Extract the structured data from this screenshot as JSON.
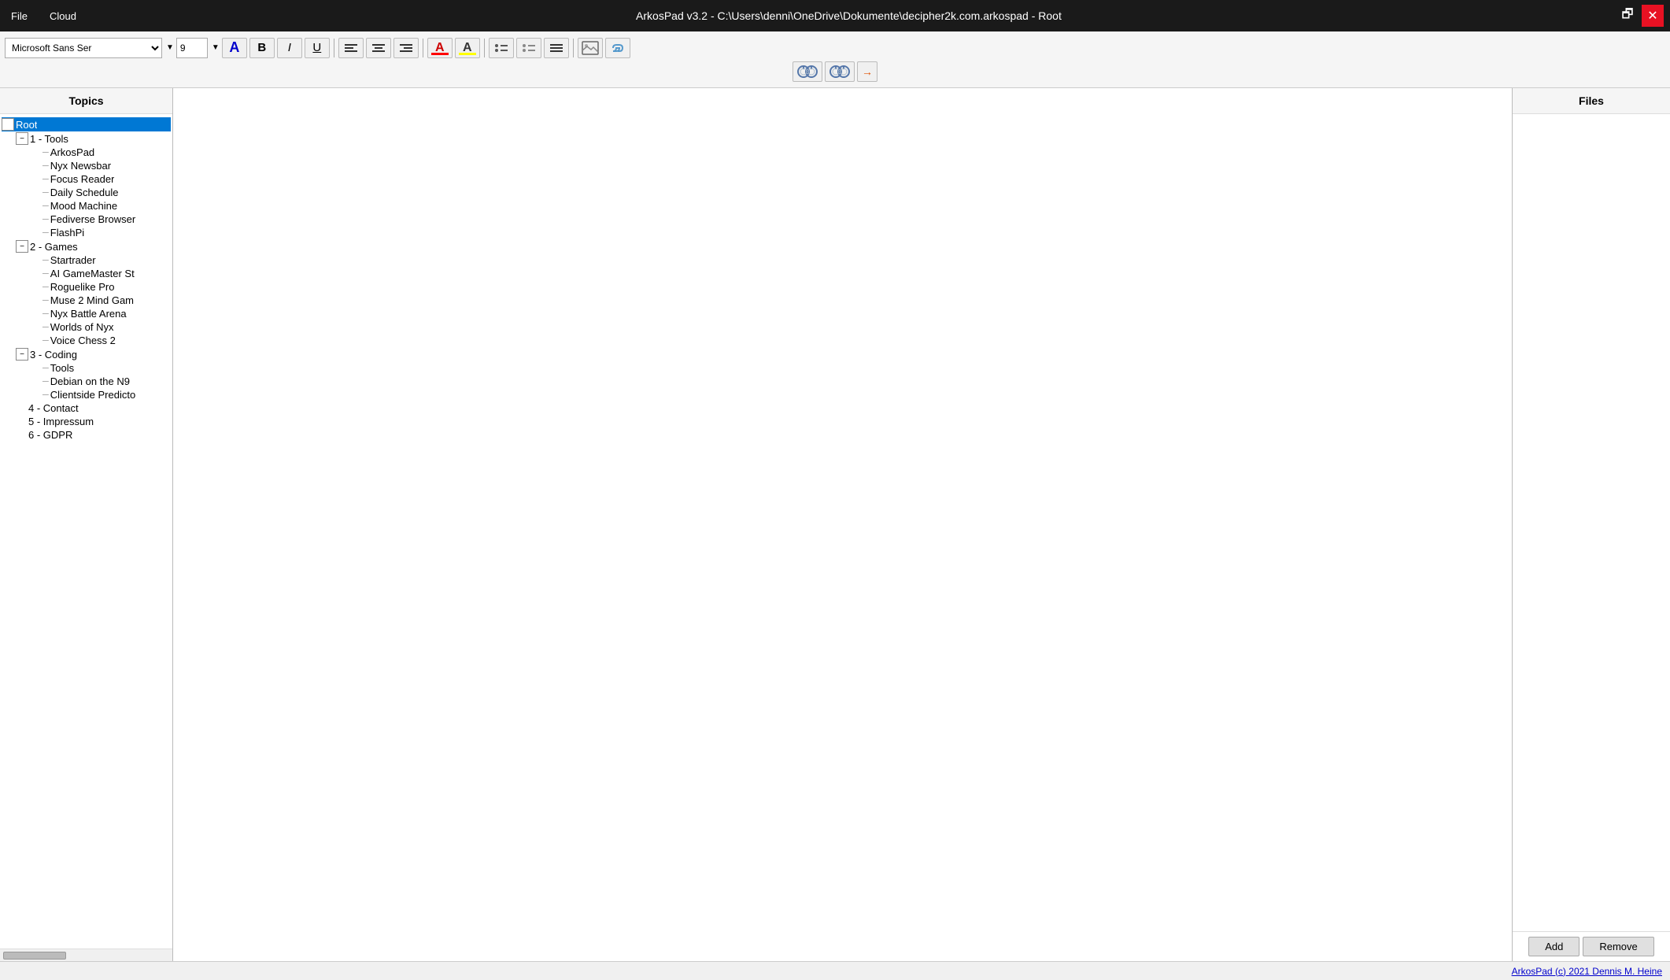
{
  "titlebar": {
    "menu_file": "File",
    "menu_cloud": "Cloud",
    "title": "ArkosPad v3.2  -  C:\\Users\\denni\\OneDrive\\Dokumente\\decipher2k.com.arkospad  -  Root",
    "btn_restore": "🗗",
    "btn_close": "✕"
  },
  "toolbar": {
    "font_name": "Microsoft Sans Ser",
    "font_size": "9",
    "btn_bold": "B",
    "btn_italic": "I",
    "btn_underline": "U",
    "btn_align_left": "≡",
    "btn_align_center": "≡",
    "btn_align_right": "≡",
    "btn_font_color": "A",
    "btn_highlight": "A",
    "btn_bullet1": "•",
    "btn_bullet2": "•",
    "btn_list": "≡",
    "btn_image": "🖼",
    "btn_link": "🔗",
    "btn_search1": "🔭",
    "btn_search2": "🔭",
    "btn_search_extend": "→"
  },
  "topics": {
    "header": "Topics",
    "tree": [
      {
        "id": "root",
        "label": "Root",
        "level": 0,
        "expanded": true,
        "selected": true,
        "hasChildren": true
      },
      {
        "id": "tools",
        "label": "1 - Tools",
        "level": 1,
        "expanded": true,
        "hasChildren": true
      },
      {
        "id": "arkospad",
        "label": "ArkosPad",
        "level": 2,
        "hasChildren": false
      },
      {
        "id": "nyx-newsbar",
        "label": "Nyx Newsbar",
        "level": 2,
        "hasChildren": false
      },
      {
        "id": "focus-reader",
        "label": "Focus Reader",
        "level": 2,
        "hasChildren": false
      },
      {
        "id": "daily-schedule",
        "label": "Daily Schedule",
        "level": 2,
        "hasChildren": false
      },
      {
        "id": "mood-machine",
        "label": "Mood Machine",
        "level": 2,
        "hasChildren": false
      },
      {
        "id": "fediverse-browser",
        "label": "Fediverse Browser",
        "level": 2,
        "hasChildren": false
      },
      {
        "id": "flashpi",
        "label": "FlashPi",
        "level": 2,
        "hasChildren": false
      },
      {
        "id": "games",
        "label": "2 - Games",
        "level": 1,
        "expanded": true,
        "hasChildren": true
      },
      {
        "id": "startrader",
        "label": "Startrader",
        "level": 2,
        "hasChildren": false
      },
      {
        "id": "ai-gamemaster",
        "label": "AI GameMaster St",
        "level": 2,
        "hasChildren": false
      },
      {
        "id": "roguelike-pro",
        "label": "Roguelike Pro",
        "level": 2,
        "hasChildren": false
      },
      {
        "id": "muse-2",
        "label": "Muse 2 Mind Gam",
        "level": 2,
        "hasChildren": false
      },
      {
        "id": "nyx-battle-arena",
        "label": "Nyx Battle Arena",
        "level": 2,
        "hasChildren": false
      },
      {
        "id": "worlds-of-nyx",
        "label": "Worlds of Nyx",
        "level": 2,
        "hasChildren": false
      },
      {
        "id": "voice-chess-2",
        "label": "Voice Chess 2",
        "level": 2,
        "hasChildren": false
      },
      {
        "id": "coding",
        "label": "3 - Coding",
        "level": 1,
        "expanded": true,
        "hasChildren": true
      },
      {
        "id": "tools-coding",
        "label": "Tools",
        "level": 2,
        "hasChildren": false
      },
      {
        "id": "debian-n9",
        "label": "Debian on the N9",
        "level": 2,
        "hasChildren": false
      },
      {
        "id": "clientside-predicto",
        "label": "Clientside Predicto",
        "level": 2,
        "hasChildren": false
      },
      {
        "id": "contact",
        "label": "4 - Contact",
        "level": 1,
        "hasChildren": false
      },
      {
        "id": "impressum",
        "label": "5 - Impressum",
        "level": 1,
        "hasChildren": false
      },
      {
        "id": "gdpr",
        "label": "6 - GDPR",
        "level": 1,
        "hasChildren": false
      }
    ]
  },
  "files": {
    "header": "Files",
    "btn_add": "Add",
    "btn_remove": "Remove"
  },
  "statusbar": {
    "text": "ArkosPad (c) 2021 Dennis M. Heine"
  }
}
